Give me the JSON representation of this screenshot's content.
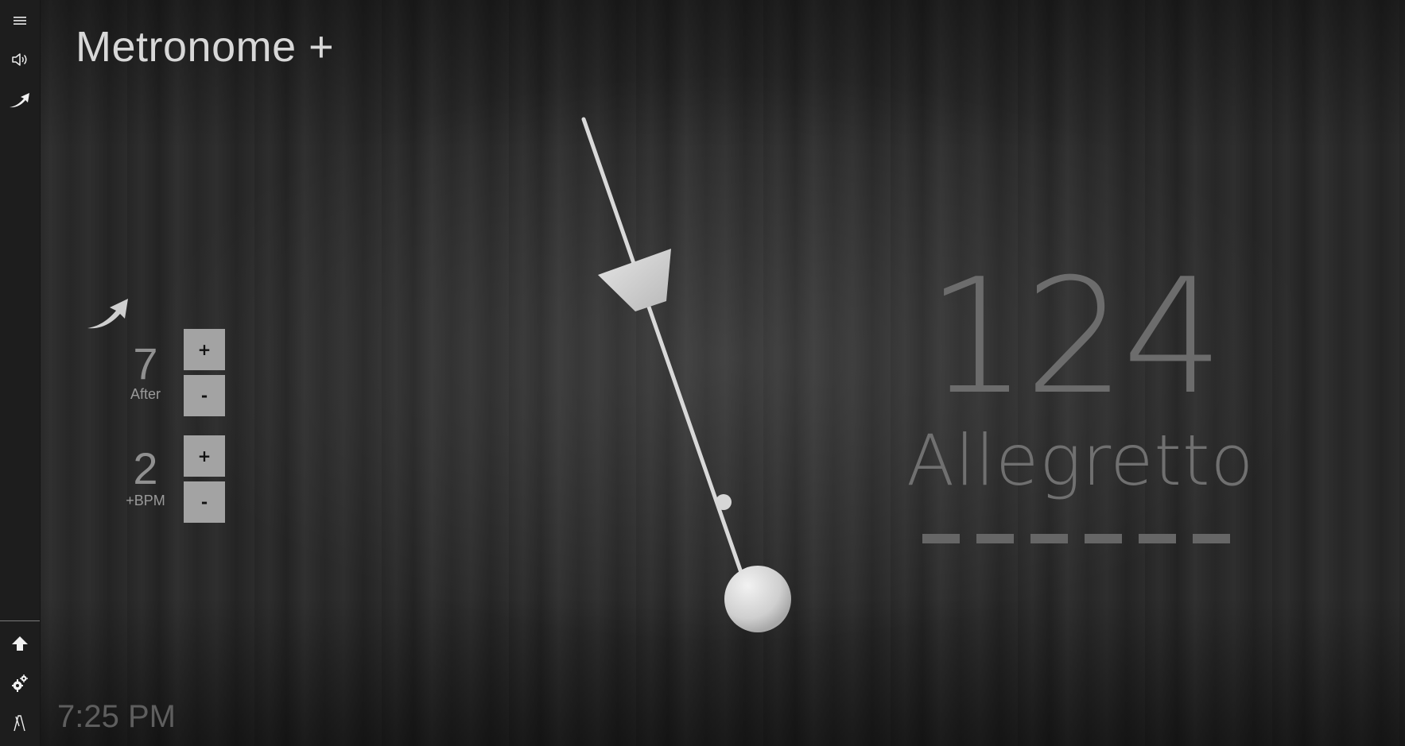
{
  "app": {
    "title": "Metronome +"
  },
  "sidebar": {
    "top": [
      {
        "icon": "hamburger-menu-icon"
      },
      {
        "icon": "speaker-volume-icon"
      },
      {
        "icon": "ramp-up-arrow-icon"
      }
    ],
    "bottom": [
      {
        "icon": "upload-arrow-icon"
      },
      {
        "icon": "gear-icon"
      },
      {
        "icon": "metronome-icon"
      }
    ]
  },
  "tempo_ramp": {
    "icon": "ramp-up-arrow-icon",
    "after": {
      "value": "7",
      "label": "After",
      "plus": "+",
      "minus": "-"
    },
    "increment": {
      "value": "2",
      "label": "+BPM",
      "plus": "+",
      "minus": "-"
    }
  },
  "display": {
    "bpm": "124",
    "tempo_name": "Allegretto",
    "beat_count": 6
  },
  "status": {
    "time": "7:25 PM"
  },
  "colors": {
    "sidebar": "#1d1d1d",
    "button": "#a3a3a3",
    "pendulum": "#d6d6d6",
    "bpm_text": "#6c6c6c",
    "beat_marker": "#666666"
  }
}
